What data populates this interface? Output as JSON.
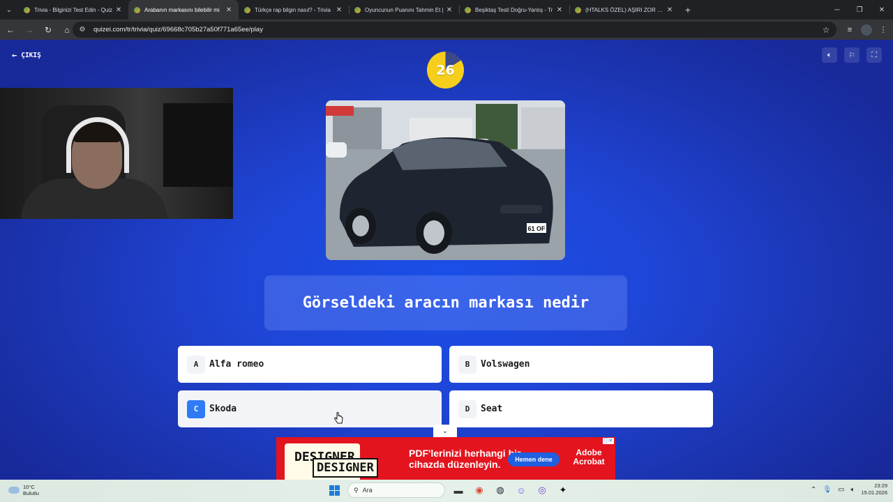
{
  "browser": {
    "tabs": [
      {
        "title": "Trivia - Bilginizi Test Edin - Quiz",
        "active": false
      },
      {
        "title": "Arabanın markasını bilebilir mi",
        "active": true
      },
      {
        "title": "Türkçe rap bilgin nasıl? - Trivia",
        "active": false
      },
      {
        "title": "Oyuncunun Puanını Tahmin Et |",
        "active": false
      },
      {
        "title": "Beşiktaş Testi Doğru-Yanlış - Tr",
        "active": false
      },
      {
        "title": "(HTALKS ÖZEL) AŞIRI ZOR FUTB",
        "active": false
      }
    ],
    "url": "quizei.com/tr/trivia/quiz/69668c705b27a50f771a65ee/play"
  },
  "quiz": {
    "exit_label": "ÇIKIŞ",
    "timer": "26",
    "timer_fraction_remaining": 0.84,
    "question": "Görseldeki aracın markası nedir",
    "car_plate": "61 OF",
    "answers": [
      {
        "letter": "A",
        "label": "Alfa romeo"
      },
      {
        "letter": "B",
        "label": "Volswagen"
      },
      {
        "letter": "C",
        "label": "Skoda"
      },
      {
        "letter": "D",
        "label": "Seat"
      }
    ]
  },
  "ad": {
    "logo_text": "DESIGNER",
    "headline": "PDF'lerinizi herhangi bir cihazda düzenleyin.",
    "cta": "Hemen dene",
    "brand": "Adobe Acrobat"
  },
  "taskbar": {
    "weather_temp": "10°C",
    "weather_desc": "Bulutlu",
    "search_placeholder": "Ara",
    "time": "23:29",
    "date": "15.01.2026"
  },
  "colors": {
    "page_blue": "#1f45d6",
    "timer_yellow": "#f6cf1c",
    "selected_letter": "#2f7bf5",
    "ad_red": "#e3141e"
  }
}
